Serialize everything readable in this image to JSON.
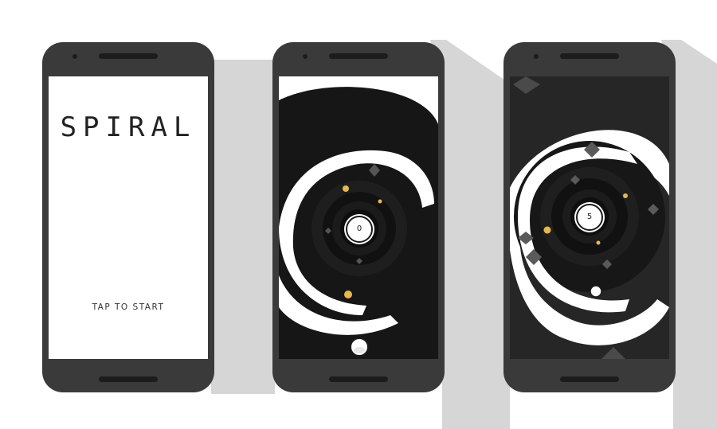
{
  "screens": {
    "start": {
      "title": "SPIRAL",
      "prompt": "TAP TO START"
    },
    "game_1": {
      "score": "0"
    },
    "game_2": {
      "score": "5"
    }
  },
  "colors": {
    "background": "#ffffff",
    "long_shadow": "#d6d6d6",
    "phone_body": "#3a3a3a",
    "spiral_track": "#161616",
    "spiral_gap": "#ffffff",
    "coin": "#e8b84a",
    "spike": "#555555"
  }
}
